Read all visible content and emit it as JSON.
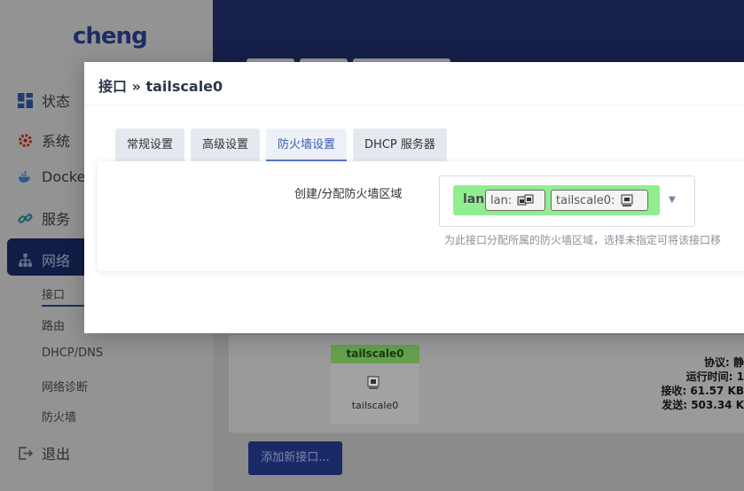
{
  "brand": {
    "logo_text": "cheng"
  },
  "sidebar": {
    "items": [
      {
        "label": "状态",
        "icon": "dashboard-icon"
      },
      {
        "label": "系统",
        "icon": "gear-icon"
      },
      {
        "label": "Docker",
        "icon": "docker-whale-icon"
      },
      {
        "label": "服务",
        "icon": "link-icon"
      },
      {
        "label": "网络",
        "icon": "network-tree-icon"
      }
    ],
    "sub_items": [
      "接口",
      "路由",
      "DHCP/DNS",
      "网络诊断",
      "防火墙"
    ],
    "logout": {
      "label": "退出",
      "icon": "logout-icon"
    }
  },
  "background": {
    "interface": {
      "badge": "tailscale0",
      "name": "tailscale0",
      "stats": [
        "协议: 静",
        "运行时间: 1",
        "接收: 61.57 KB",
        "发送: 503.34 K"
      ]
    },
    "add_button": "添加新接口..."
  },
  "modal": {
    "title": "接口 » tailscale0",
    "tabs": [
      {
        "label": "常规设置"
      },
      {
        "label": "高级设置"
      },
      {
        "label": "防火墙设置",
        "active": true
      },
      {
        "label": "DHCP 服务器"
      }
    ],
    "firewall": {
      "field_label": "创建/分配防火墙区域",
      "zone": {
        "name": "lan",
        "color": "#90ee90"
      },
      "networks": [
        {
          "label": "lan:",
          "icon": "ethernet-ports-icon"
        },
        {
          "label": "tailscale0:",
          "icon": "ethernet-port-icon"
        }
      ],
      "help": "为此接口分配所属的防火墙区域，选择未指定可将该接口移"
    }
  },
  "colors": {
    "active_tab": "#3a5bb5",
    "sidebar_active": "#111d47",
    "zone_lan": "#90ee90"
  }
}
